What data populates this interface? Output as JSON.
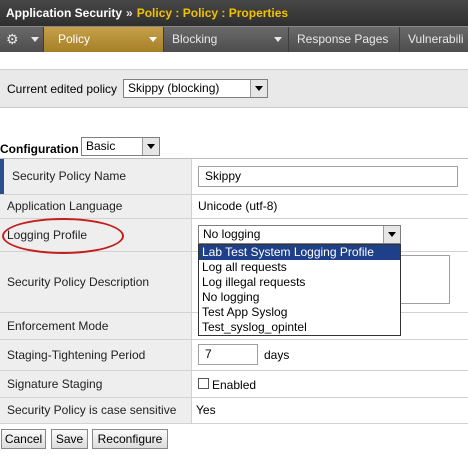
{
  "header": {
    "app_title": "Application Security",
    "separator": "»",
    "breadcrumb": "Policy : Policy : Properties"
  },
  "tabs": [
    {
      "label": "Policy",
      "active": true
    },
    {
      "label": "Blocking",
      "active": false
    },
    {
      "label": "Response Pages",
      "active": false
    },
    {
      "label": "Vulnerabili",
      "active": false
    }
  ],
  "policy_selector": {
    "label": "Current edited policy",
    "value": "Skippy (blocking)"
  },
  "configuration": {
    "label": "Configuration",
    "value": "Basic"
  },
  "properties": {
    "security_policy_name": {
      "label": "Security Policy Name",
      "value": "Skippy"
    },
    "application_language": {
      "label": "Application Language",
      "value": "Unicode (utf-8)"
    },
    "logging_profile": {
      "label": "Logging Profile",
      "value": "No logging",
      "options": [
        "Lab Test System Logging Profile",
        "Log all requests",
        "Log illegal requests",
        "No logging",
        "Test App Syslog",
        "Test_syslog_opintel"
      ],
      "highlighted": "Lab Test System Logging Profile"
    },
    "security_policy_description": {
      "label": "Security Policy Description",
      "value": ""
    },
    "enforcement_mode": {
      "label": "Enforcement Mode"
    },
    "staging_period": {
      "label": "Staging-Tightening Period",
      "value": "7",
      "unit": "days"
    },
    "signature_staging": {
      "label": "Signature Staging",
      "checkbox_label": "Enabled",
      "checked": false
    },
    "case_sensitive": {
      "label": "Security Policy is case sensitive",
      "value": "Yes"
    }
  },
  "buttons": {
    "cancel": "Cancel",
    "save": "Save",
    "reconfigure": "Reconfigure"
  },
  "colors": {
    "active_tab": "#b08a36",
    "breadcrumb": "#f2c200",
    "highlight": "#1e3f8a",
    "annotation": "#c41e1e"
  }
}
